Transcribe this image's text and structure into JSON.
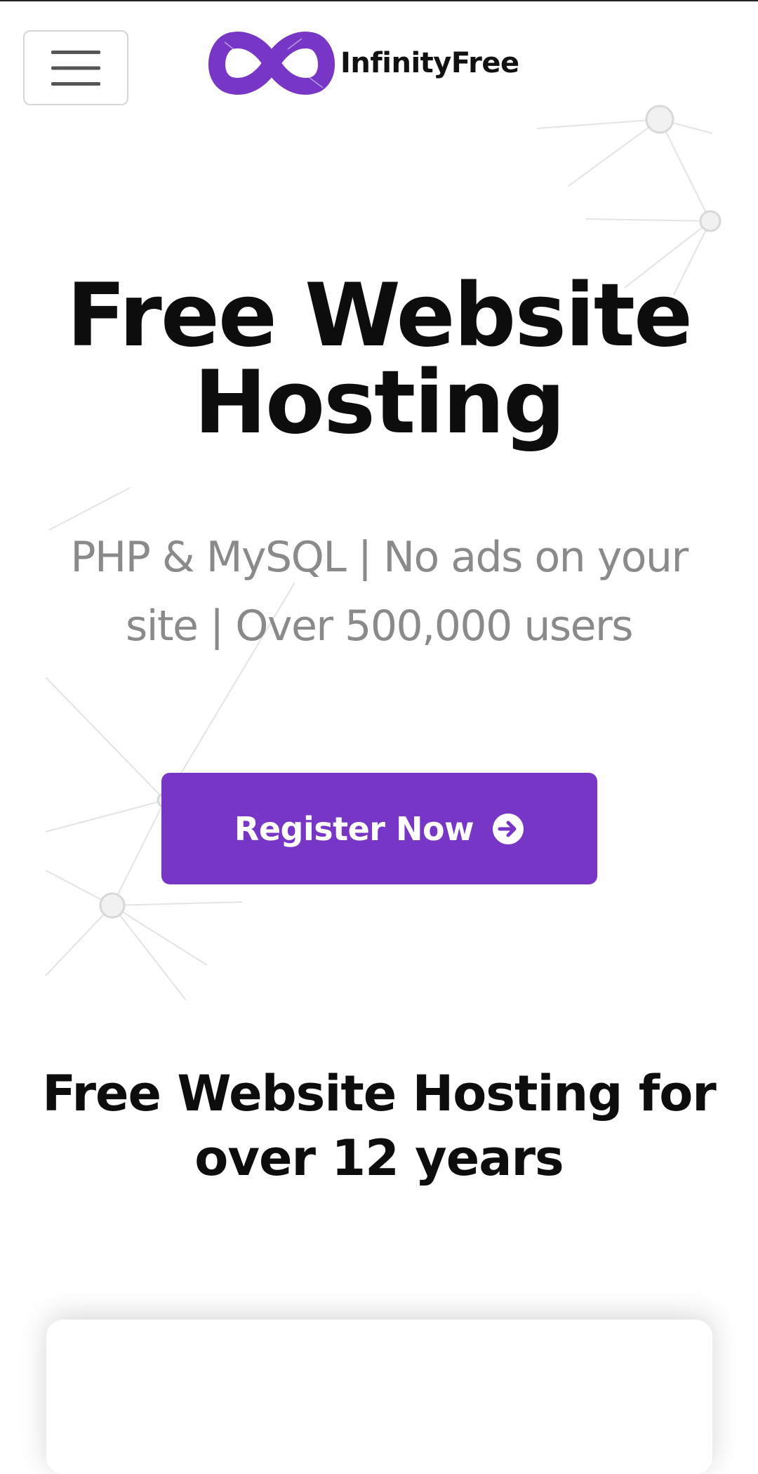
{
  "header": {
    "menu_icon": "hamburger-menu-icon",
    "brand_name": "InfinityFree",
    "logo_icon": "infinity-logo-icon",
    "brand_color": "#7736c6"
  },
  "hero": {
    "title": "Free Website Hosting",
    "subtitle": "PHP & MySQL | No ads on your site | Over 500,000 users",
    "cta_label": "Register Now",
    "cta_icon": "arrow-right-circle-icon",
    "cta_color": "#7736c6"
  },
  "section": {
    "heading": "Free Website Hosting for over 12 years"
  }
}
